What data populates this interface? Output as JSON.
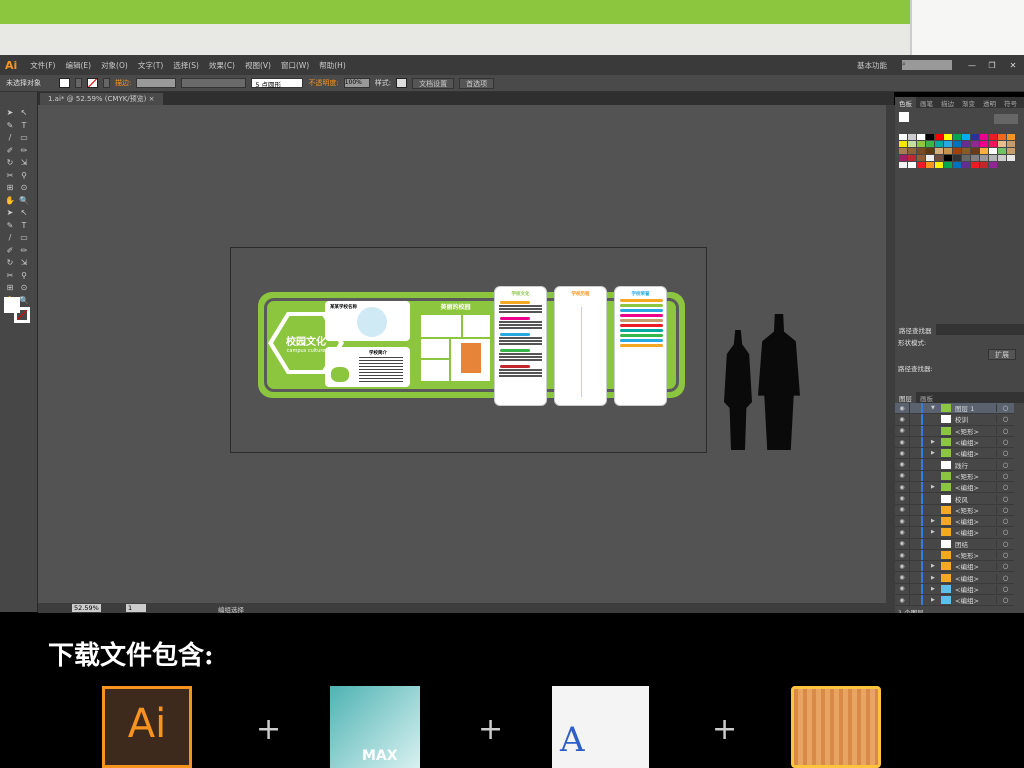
{
  "app": {
    "logo": "Ai",
    "workspace": "基本功能"
  },
  "menu": [
    "文件(F)",
    "编辑(E)",
    "对象(O)",
    "文字(T)",
    "选择(S)",
    "效果(C)",
    "视图(V)",
    "窗口(W)",
    "帮助(H)"
  ],
  "control": {
    "selection": "未选择对象",
    "stroke_label": "描边:",
    "brush": "5 点圆形",
    "opacity_label": "不透明度:",
    "opacity": "100%",
    "style_label": "样式:",
    "doc_setup": "文档设置",
    "prefs": "首选项"
  },
  "document": {
    "tab": "1.ai* @ 52.59% (CMYK/预览)",
    "close": "×"
  },
  "status": {
    "zoom": "52.59%",
    "page": "1",
    "tool": "编组选择"
  },
  "design": {
    "title_cn": "校园文化",
    "title_en": "campus culture",
    "beautiful_campus": "美丽的校园",
    "school_intro": "学校简介",
    "school_name": "某某学校名称",
    "panel1": "学校文化",
    "panel2": "学校历程",
    "panel3": "学校荣誉"
  },
  "swatches_panel": {
    "tabs": [
      "色板",
      "画笔",
      "描边",
      "渐变",
      "透明",
      "符号"
    ]
  },
  "pathfinder": {
    "tabs": [
      "路径查找器"
    ],
    "shape_modes": "形状模式:",
    "expand": "扩展",
    "pathfinders": "路径查找器:"
  },
  "layers_panel": {
    "tabs": [
      "图层",
      "画板"
    ],
    "footer": "1 个图层",
    "items": [
      {
        "name": "图层 1",
        "arrow": "▼",
        "thumb": "#8cc63f"
      },
      {
        "name": "校训",
        "thumb": "#ffffff"
      },
      {
        "name": "<矩形>",
        "thumb": "#8cc63f"
      },
      {
        "name": "<编组>",
        "arrow": "▶",
        "thumb": "#8cc63f"
      },
      {
        "name": "<编组>",
        "arrow": "▶",
        "thumb": "#8cc63f"
      },
      {
        "name": "践行",
        "thumb": "#ffffff"
      },
      {
        "name": "<矩形>",
        "thumb": "#8cc63f"
      },
      {
        "name": "<编组>",
        "arrow": "▶",
        "thumb": "#8cc63f"
      },
      {
        "name": "校风",
        "thumb": "#ffffff"
      },
      {
        "name": "<矩形>",
        "thumb": "#f7a823"
      },
      {
        "name": "<编组>",
        "arrow": "▶",
        "thumb": "#f7a823"
      },
      {
        "name": "<编组>",
        "arrow": "▶",
        "thumb": "#f7a823"
      },
      {
        "name": "团结",
        "thumb": "#ffffff"
      },
      {
        "name": "<矩形>",
        "thumb": "#f7a823"
      },
      {
        "name": "<编组>",
        "arrow": "▶",
        "thumb": "#f7a823"
      },
      {
        "name": "<编组>",
        "arrow": "▶",
        "thumb": "#f7a823"
      },
      {
        "name": "<编组>",
        "arrow": "▶",
        "thumb": "#5bc0eb"
      },
      {
        "name": "<编组>",
        "arrow": "▶",
        "thumb": "#5bc0eb"
      }
    ]
  },
  "swatch_colors": [
    "#ffffff",
    "#cccccc",
    "#ffffff",
    "#000000",
    "#ff0000",
    "#ffff00",
    "#00a651",
    "#00aeef",
    "#2e3192",
    "#ec008c",
    "#ed1c24",
    "#f26522",
    "#f7941d",
    "#f7e700",
    "#c4df9b",
    "#8dc63f",
    "#39b54a",
    "#00a99d",
    "#27aae1",
    "#0072bc",
    "#662d91",
    "#92278f",
    "#ec008c",
    "#ed145b",
    "#e3c08b",
    "#c69c6d",
    "#a67c52",
    "#8c6239",
    "#754c24",
    "#603913",
    "#d6ac79",
    "#c7924c",
    "#a0410d",
    "#8b5a2b",
    "#6b3a1a",
    "#fbb040",
    "#ffffff",
    "#72c165",
    "#c69c6d",
    "#9e1f63",
    "#c1272d",
    "#8b5e3c",
    "#eeeeee",
    "#6d4c41",
    "#000000",
    "#333333",
    "#666666",
    "#808080",
    "#999999",
    "#b3b3b3",
    "#cccccc",
    "#e6e6e6",
    "#f2f2f2",
    "#ffffff",
    "#ed1c24",
    "#f7941d",
    "#fff200",
    "#00a651",
    "#0072bc",
    "#662d91",
    "#ed1c24",
    "#c1272d",
    "#92278f"
  ],
  "bottom": {
    "title": "下载文件包含:",
    "plus": "+",
    "icons": [
      {
        "name": "adobe-illustrator",
        "label": "Ai"
      },
      {
        "name": "3ds-max",
        "label": "MAX"
      },
      {
        "name": "font-file",
        "label": "A"
      },
      {
        "name": "wood-texture",
        "label": ""
      }
    ]
  }
}
